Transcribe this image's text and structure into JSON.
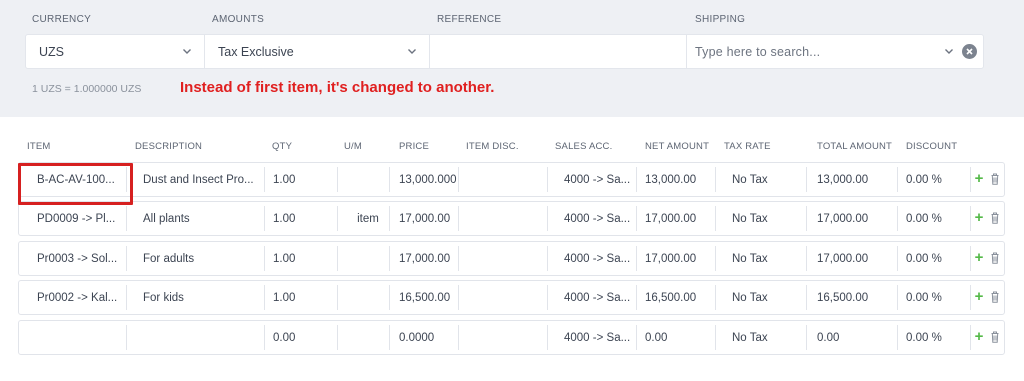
{
  "header": {
    "currency_label": "CURRENCY",
    "amounts_label": "AMOUNTS",
    "reference_label": "REFERENCE",
    "shipping_label": "SHIPPING"
  },
  "fields": {
    "currency_value": "UZS",
    "amounts_value": "Tax Exclusive",
    "reference_value": "",
    "shipping_placeholder": "Type here to search..."
  },
  "exchange_rate": "1 UZS = 1.000000 UZS",
  "annotation": "Instead of first item, it's changed to another.",
  "table": {
    "columns": [
      "ITEM",
      "DESCRIPTION",
      "QTY",
      "U/M",
      "PRICE",
      "ITEM DISC.",
      "SALES ACC.",
      "NET AMOUNT",
      "TAX RATE",
      "TOTAL AMOUNT",
      "DISCOUNT"
    ],
    "rows": [
      {
        "item": "B-AC-AV-100...",
        "description": "Dust and Insect Pro...",
        "qty": "1.00",
        "um": "",
        "price": "13,000.000",
        "item_disc": "",
        "sales_acc": "4000 -> Sa...",
        "net_amount": "13,000.00",
        "tax_rate": "No Tax",
        "total_amount": "13,000.00",
        "discount": "0.00 %"
      },
      {
        "item": "PD0009 -> Pl...",
        "description": "All plants",
        "qty": "1.00",
        "um": "item",
        "price": "17,000.00",
        "item_disc": "",
        "sales_acc": "4000 -> Sa...",
        "net_amount": "17,000.00",
        "tax_rate": "No Tax",
        "total_amount": "17,000.00",
        "discount": "0.00 %"
      },
      {
        "item": "Pr0003 -> Sol...",
        "description": "For adults",
        "qty": "1.00",
        "um": "",
        "price": "17,000.00",
        "item_disc": "",
        "sales_acc": "4000 -> Sa...",
        "net_amount": "17,000.00",
        "tax_rate": "No Tax",
        "total_amount": "17,000.00",
        "discount": "0.00 %"
      },
      {
        "item": "Pr0002 -> Kal...",
        "description": "For kids",
        "qty": "1.00",
        "um": "",
        "price": "16,500.00",
        "item_disc": "",
        "sales_acc": "4000 -> Sa...",
        "net_amount": "16,500.00",
        "tax_rate": "No Tax",
        "total_amount": "16,500.00",
        "discount": "0.00 %"
      },
      {
        "item": "",
        "description": "",
        "qty": "0.00",
        "um": "",
        "price": "0.0000",
        "item_disc": "",
        "sales_acc": "4000 -> Sa...",
        "net_amount": "0.00",
        "tax_rate": "No Tax",
        "total_amount": "0.00",
        "discount": "0.00 %"
      }
    ]
  },
  "icons": {
    "add": "plus-icon",
    "delete": "trash-icon",
    "dropdown": "chevron-down-icon",
    "clear": "close-circle-icon"
  },
  "colors": {
    "annotation": "#e02020",
    "highlight_box": "#d62020",
    "add_icon": "#54b948"
  }
}
